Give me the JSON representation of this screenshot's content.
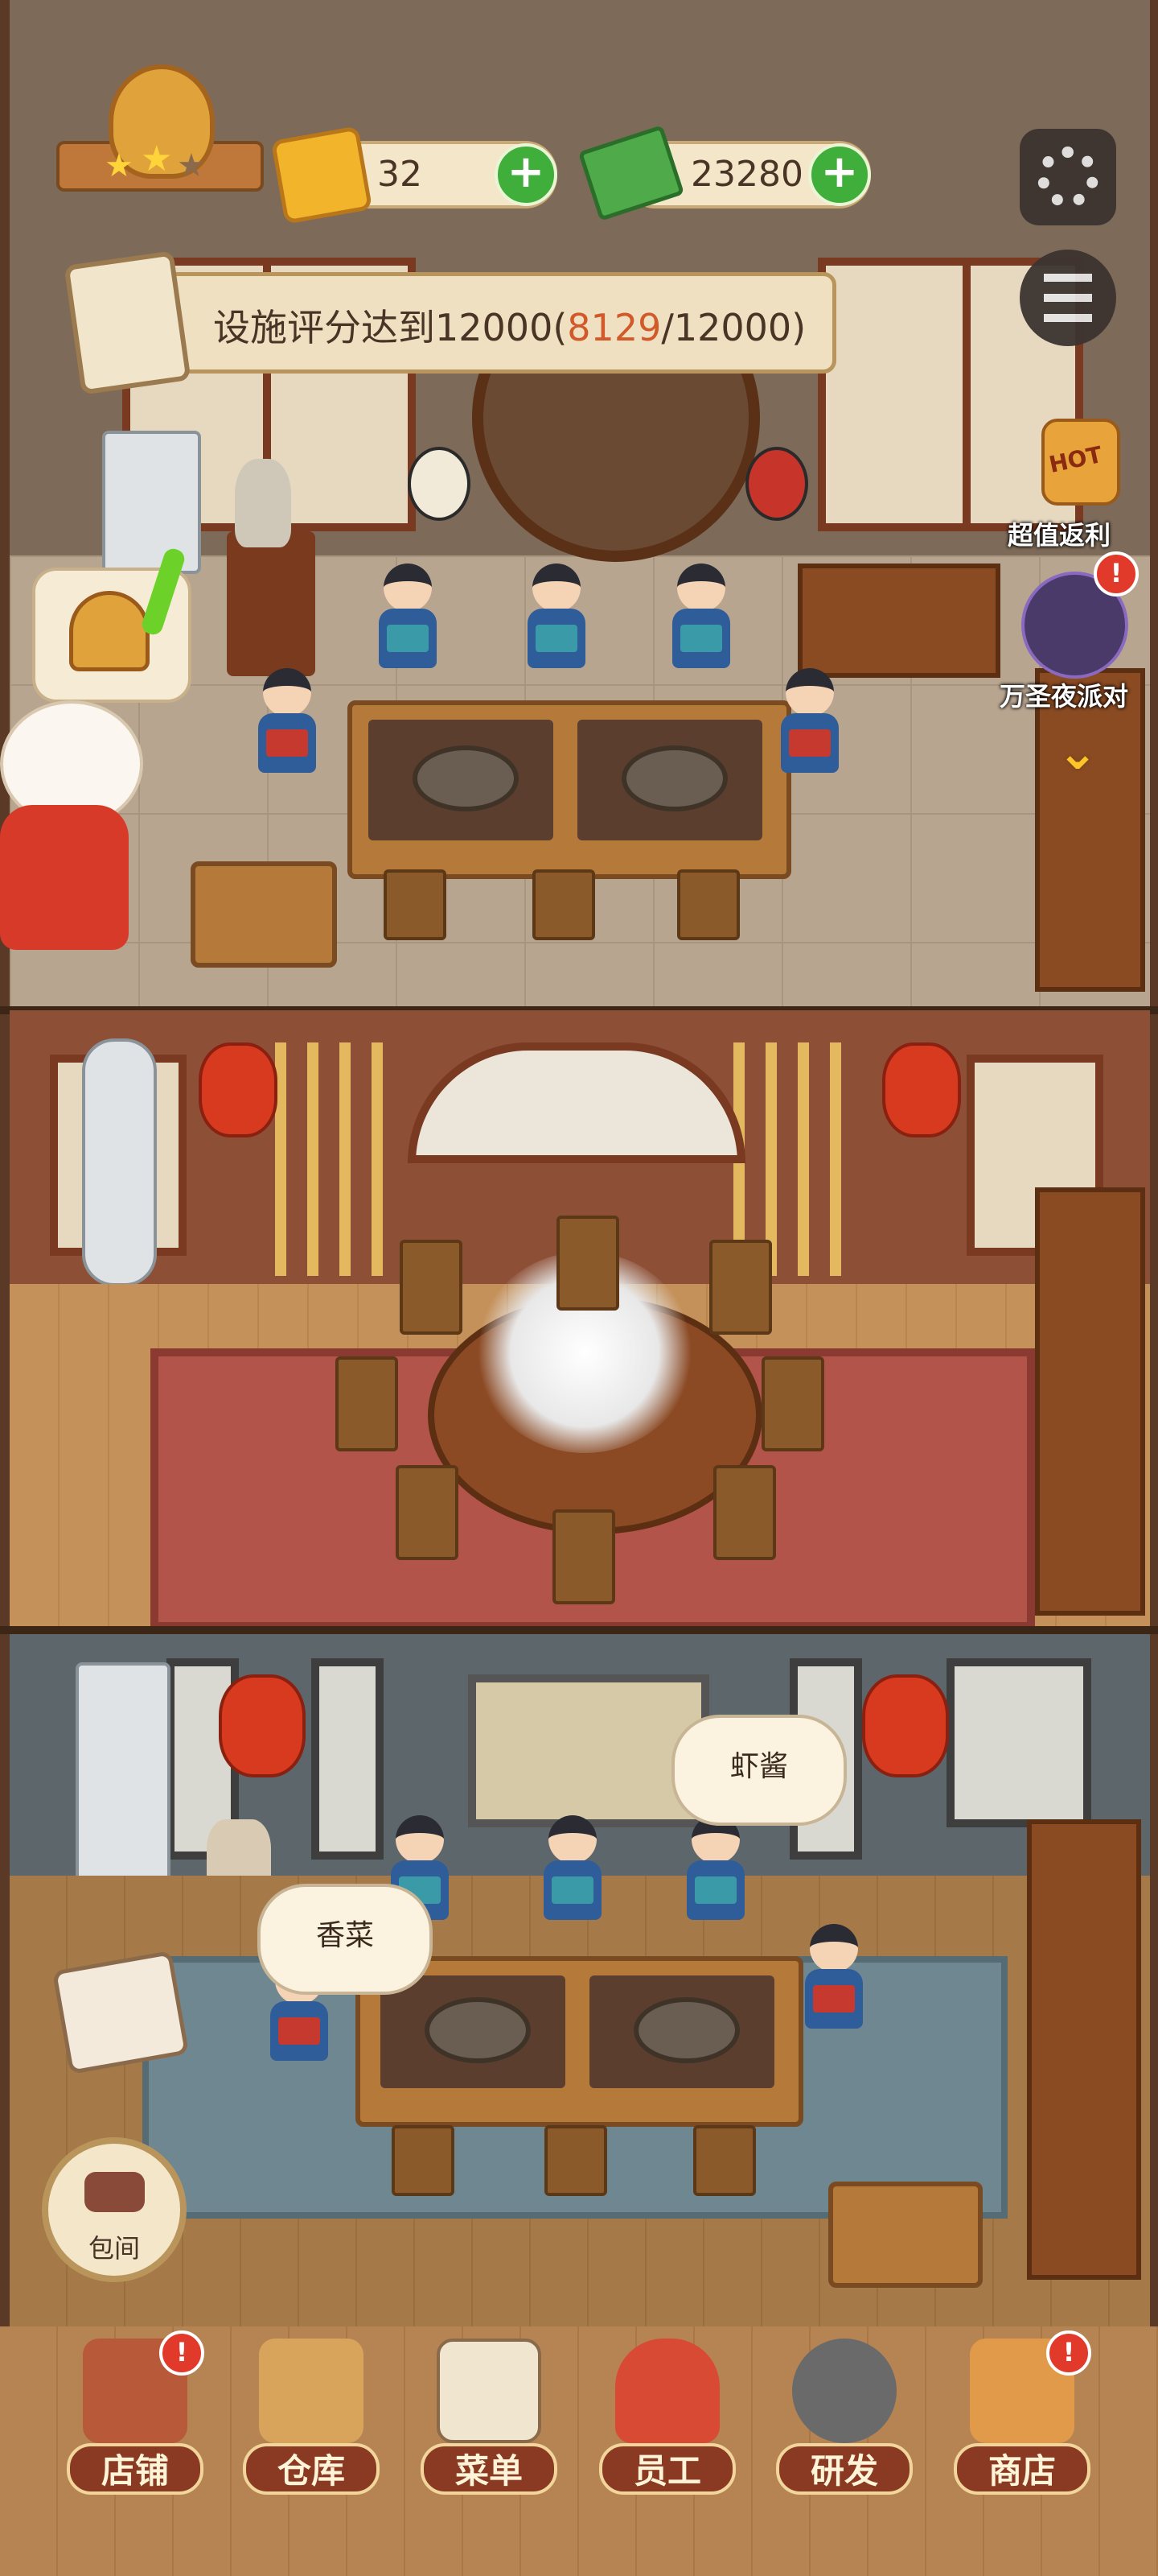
{
  "hud": {
    "gem_count": "32",
    "cash_count": "23280",
    "plus_glyph": "+"
  },
  "quest": {
    "prefix": "设施评分达到12000(",
    "current": "8129",
    "suffix": "/12000)"
  },
  "side": {
    "promo1_label": "超值返利",
    "promo2_label": "万圣夜派对",
    "promo1_badge_text": "HOT"
  },
  "bubbles": {
    "shrimp_paste": "虾酱",
    "cilantro": "香菜"
  },
  "private_room_label": "包间",
  "nav": [
    {
      "label": "店铺",
      "badge": "!"
    },
    {
      "label": "仓库",
      "badge": ""
    },
    {
      "label": "菜单",
      "badge": ""
    },
    {
      "label": "员工",
      "badge": ""
    },
    {
      "label": "研发",
      "badge": ""
    },
    {
      "label": "商店",
      "badge": "!"
    }
  ],
  "colors": {
    "accent_red": "#d25a2a",
    "plus_green": "#3fae3a",
    "badge_red": "#e23a2a"
  },
  "icons": [
    "trophy-icon",
    "gem-icon",
    "cash-icon",
    "settings-gear-icon",
    "menu-list-icon",
    "bell-icon",
    "lucky-cat-icon",
    "recipe-book-icon",
    "sofa-icon",
    "shop-icon",
    "warehouse-icon",
    "menu-clipboard-icon",
    "staff-icon",
    "wok-icon",
    "store-icon"
  ]
}
